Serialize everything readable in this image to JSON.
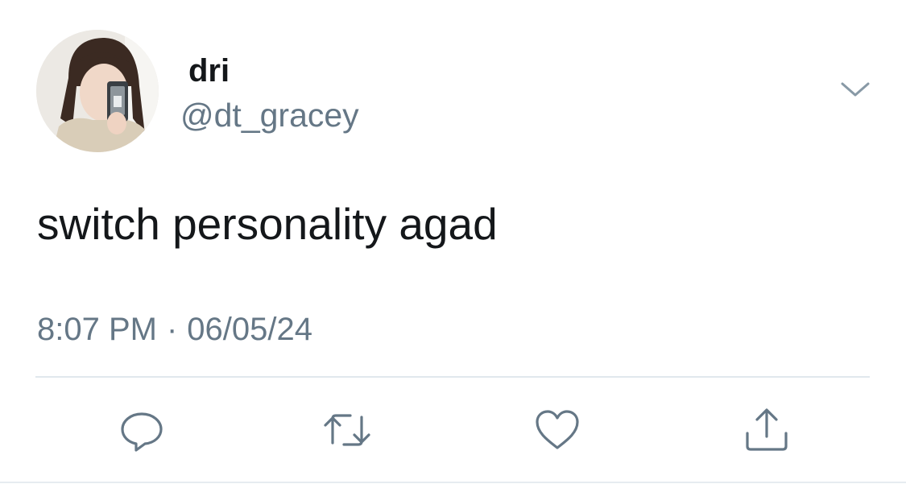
{
  "tweet": {
    "author": {
      "display_name": "dri",
      "handle": "@dt_gracey"
    },
    "text": "switch personality agad",
    "time": "8:07 PM",
    "separator": "·",
    "date": "06/05/24"
  },
  "icons": {
    "menu": "chevron-down-icon",
    "reply": "reply-icon",
    "retweet": "retweet-icon",
    "like": "heart-icon",
    "share": "share-icon"
  },
  "colors": {
    "primary_text": "#14171a",
    "secondary_text": "#657786",
    "icon": "#657786",
    "divider": "#e1e8ed",
    "background": "#ffffff"
  }
}
